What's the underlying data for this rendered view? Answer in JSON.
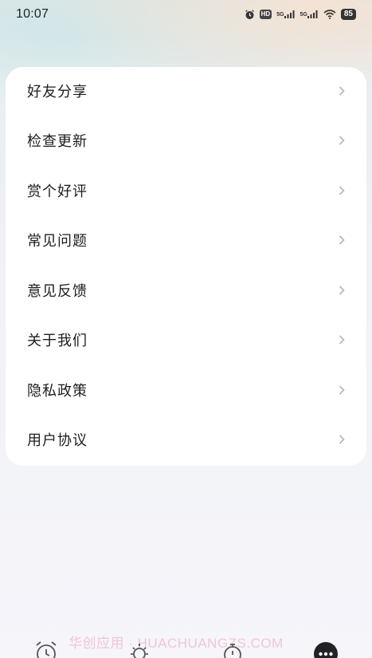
{
  "status_bar": {
    "time": "10:07",
    "hd_label": "HD",
    "signal1_label": "5G",
    "signal2_label": "5G",
    "battery": "85",
    "icons": [
      "alarm-icon",
      "hd-icon",
      "signal-icon",
      "signal-icon",
      "wifi-icon",
      "battery-icon"
    ]
  },
  "menu": {
    "items": [
      {
        "label": "好友分享"
      },
      {
        "label": "检查更新"
      },
      {
        "label": "赏个好评"
      },
      {
        "label": "常见问题"
      },
      {
        "label": "意见反馈"
      },
      {
        "label": "关于我们"
      },
      {
        "label": "隐私政策"
      },
      {
        "label": "用户协议"
      }
    ]
  },
  "tabbar": {
    "tabs": [
      {
        "icon": "alarm-clock-icon",
        "active": false
      },
      {
        "icon": "sun-icon",
        "active": false
      },
      {
        "icon": "timer-icon",
        "active": false
      },
      {
        "icon": "more-icon",
        "active": true
      }
    ]
  },
  "watermark": "华创应用 · HUACHUANGZS.COM",
  "colors": {
    "card": "#ffffff",
    "text": "#1d1d1d",
    "chevron": "#b5b5b5",
    "tab_active": "#222222"
  }
}
